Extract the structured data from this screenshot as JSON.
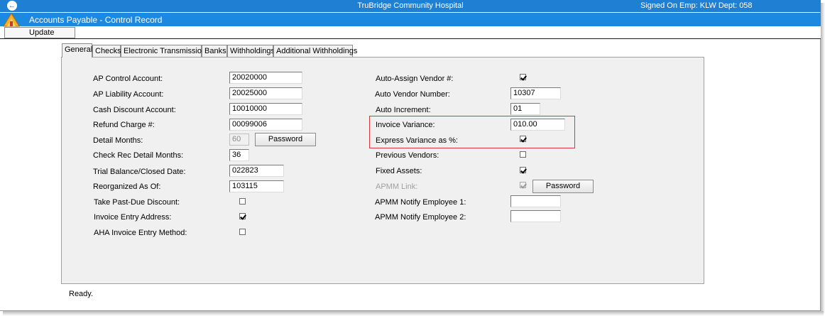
{
  "titlebar": {
    "app_title": "TruBridge Community Hospital",
    "signon": "Signed On Emp: KLW  Dept: 058"
  },
  "window": {
    "title": "Accounts Payable - Control Record"
  },
  "menu": {
    "update": "Update"
  },
  "tabs": [
    {
      "label": "General",
      "active": true
    },
    {
      "label": "Checks"
    },
    {
      "label": "Electronic Transmission"
    },
    {
      "label": "Banks"
    },
    {
      "label": "Withholdings"
    },
    {
      "label": "Additional Withholdings"
    }
  ],
  "left": {
    "ap_control_account": {
      "label": "AP Control Account:",
      "value": "20020000"
    },
    "ap_liability_account": {
      "label": "AP Liability Account:",
      "value": "20025000"
    },
    "cash_discount_account": {
      "label": "Cash Discount Account:",
      "value": "10010000"
    },
    "refund_charge": {
      "label": "Refund Charge #:",
      "value": "00099006"
    },
    "detail_months": {
      "label": "Detail Months:",
      "value": "60",
      "button": "Password"
    },
    "check_rec_detail_months": {
      "label": "Check Rec Detail Months:",
      "value": "36"
    },
    "trial_balance_closed_date": {
      "label": "Trial Balance/Closed Date:",
      "value": "022823"
    },
    "reorganized_as_of": {
      "label": "Reorganized As Of:",
      "value": "103115"
    },
    "take_past_due_discount": {
      "label": "Take Past-Due Discount:",
      "checked": false
    },
    "invoice_entry_address": {
      "label": "Invoice Entry Address:",
      "checked": true
    },
    "aha_invoice_entry_method": {
      "label": "AHA Invoice Entry Method:",
      "checked": false
    }
  },
  "right": {
    "auto_assign_vendor": {
      "label": "Auto-Assign Vendor #:",
      "checked": true
    },
    "auto_vendor_number": {
      "label": "Auto Vendor Number:",
      "value": "10307"
    },
    "auto_increment": {
      "label": "Auto Increment:",
      "value": "01"
    },
    "invoice_variance": {
      "label": "Invoice Variance:",
      "value": "010.00"
    },
    "express_variance_pct": {
      "label": "Express Variance as %:",
      "checked": true
    },
    "previous_vendors": {
      "label": "Previous Vendors:",
      "checked": false
    },
    "fixed_assets": {
      "label": "Fixed Assets:",
      "checked": true
    },
    "apmm_link": {
      "label": "APMM Link:",
      "checked": true,
      "button": "Password"
    },
    "apmm_notify_employee_1": {
      "label": "APMM Notify Employee 1:",
      "value": ""
    },
    "apmm_notify_employee_2": {
      "label": "APMM Notify Employee 2:",
      "value": ""
    }
  },
  "status": {
    "text": "Ready."
  },
  "colors": {
    "titlebar": "#1f7fd2",
    "subtitlebar": "#1c89e0",
    "highlight_box": "#d9363e",
    "panel_background": "#f0f0f0"
  }
}
